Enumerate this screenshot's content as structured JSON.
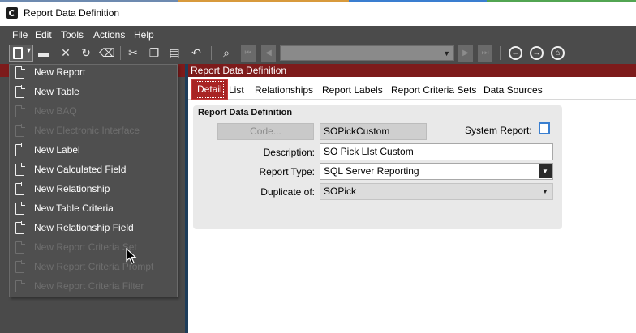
{
  "window": {
    "title": "Report Data Definition"
  },
  "menu": [
    "File",
    "Edit",
    "Tools",
    "Actions",
    "Help"
  ],
  "toolbar": {
    "icons": [
      "new-icon",
      "save-icon",
      "delete-icon",
      "refresh-icon",
      "clear-icon",
      "cut-icon",
      "copy-icon",
      "paste-icon",
      "undo-icon",
      "search-icon",
      "first-icon",
      "previous-icon",
      "next-icon",
      "last-icon",
      "back-icon",
      "forward-icon",
      "home-icon"
    ],
    "navigation_value": ""
  },
  "new_menu": {
    "items": [
      {
        "label": "New Report",
        "enabled": true
      },
      {
        "label": "New Table",
        "enabled": true
      },
      {
        "label": "New BAQ",
        "enabled": false
      },
      {
        "label": "New Electronic Interface",
        "enabled": false
      },
      {
        "label": "New Label",
        "enabled": true
      },
      {
        "label": "New Calculated Field",
        "enabled": true
      },
      {
        "label": "New Relationship",
        "enabled": true
      },
      {
        "label": "New Table Criteria",
        "enabled": true
      },
      {
        "label": "New Relationship Field",
        "enabled": true
      },
      {
        "label": "New Report Criteria Set",
        "enabled": false
      },
      {
        "label": "New Report Criteria Prompt",
        "enabled": false
      },
      {
        "label": "New Report Criteria Filter",
        "enabled": false
      }
    ]
  },
  "panel": {
    "header": "Report Data Definition"
  },
  "tabs": [
    "Detail",
    "List",
    "Relationships",
    "Report Labels",
    "Report Criteria Sets",
    "Data Sources"
  ],
  "form": {
    "group_title": "Report Data Definition",
    "code_button": "Code...",
    "code_value": "SOPickCustom",
    "system_report_label": "System Report:",
    "system_report_checked": false,
    "description_label": "Description:",
    "description_value": "SO Pick LIst Custom",
    "report_type_label": "Report Type:",
    "report_type_value": "SQL Server Reporting",
    "duplicate_label": "Duplicate of:",
    "duplicate_value": "SOPick"
  },
  "colors": {
    "header_bar": "#7d1b1b",
    "active_tab": "#a82424",
    "background": "#4a4a4a",
    "checkbox_border": "#3a7fd0"
  }
}
